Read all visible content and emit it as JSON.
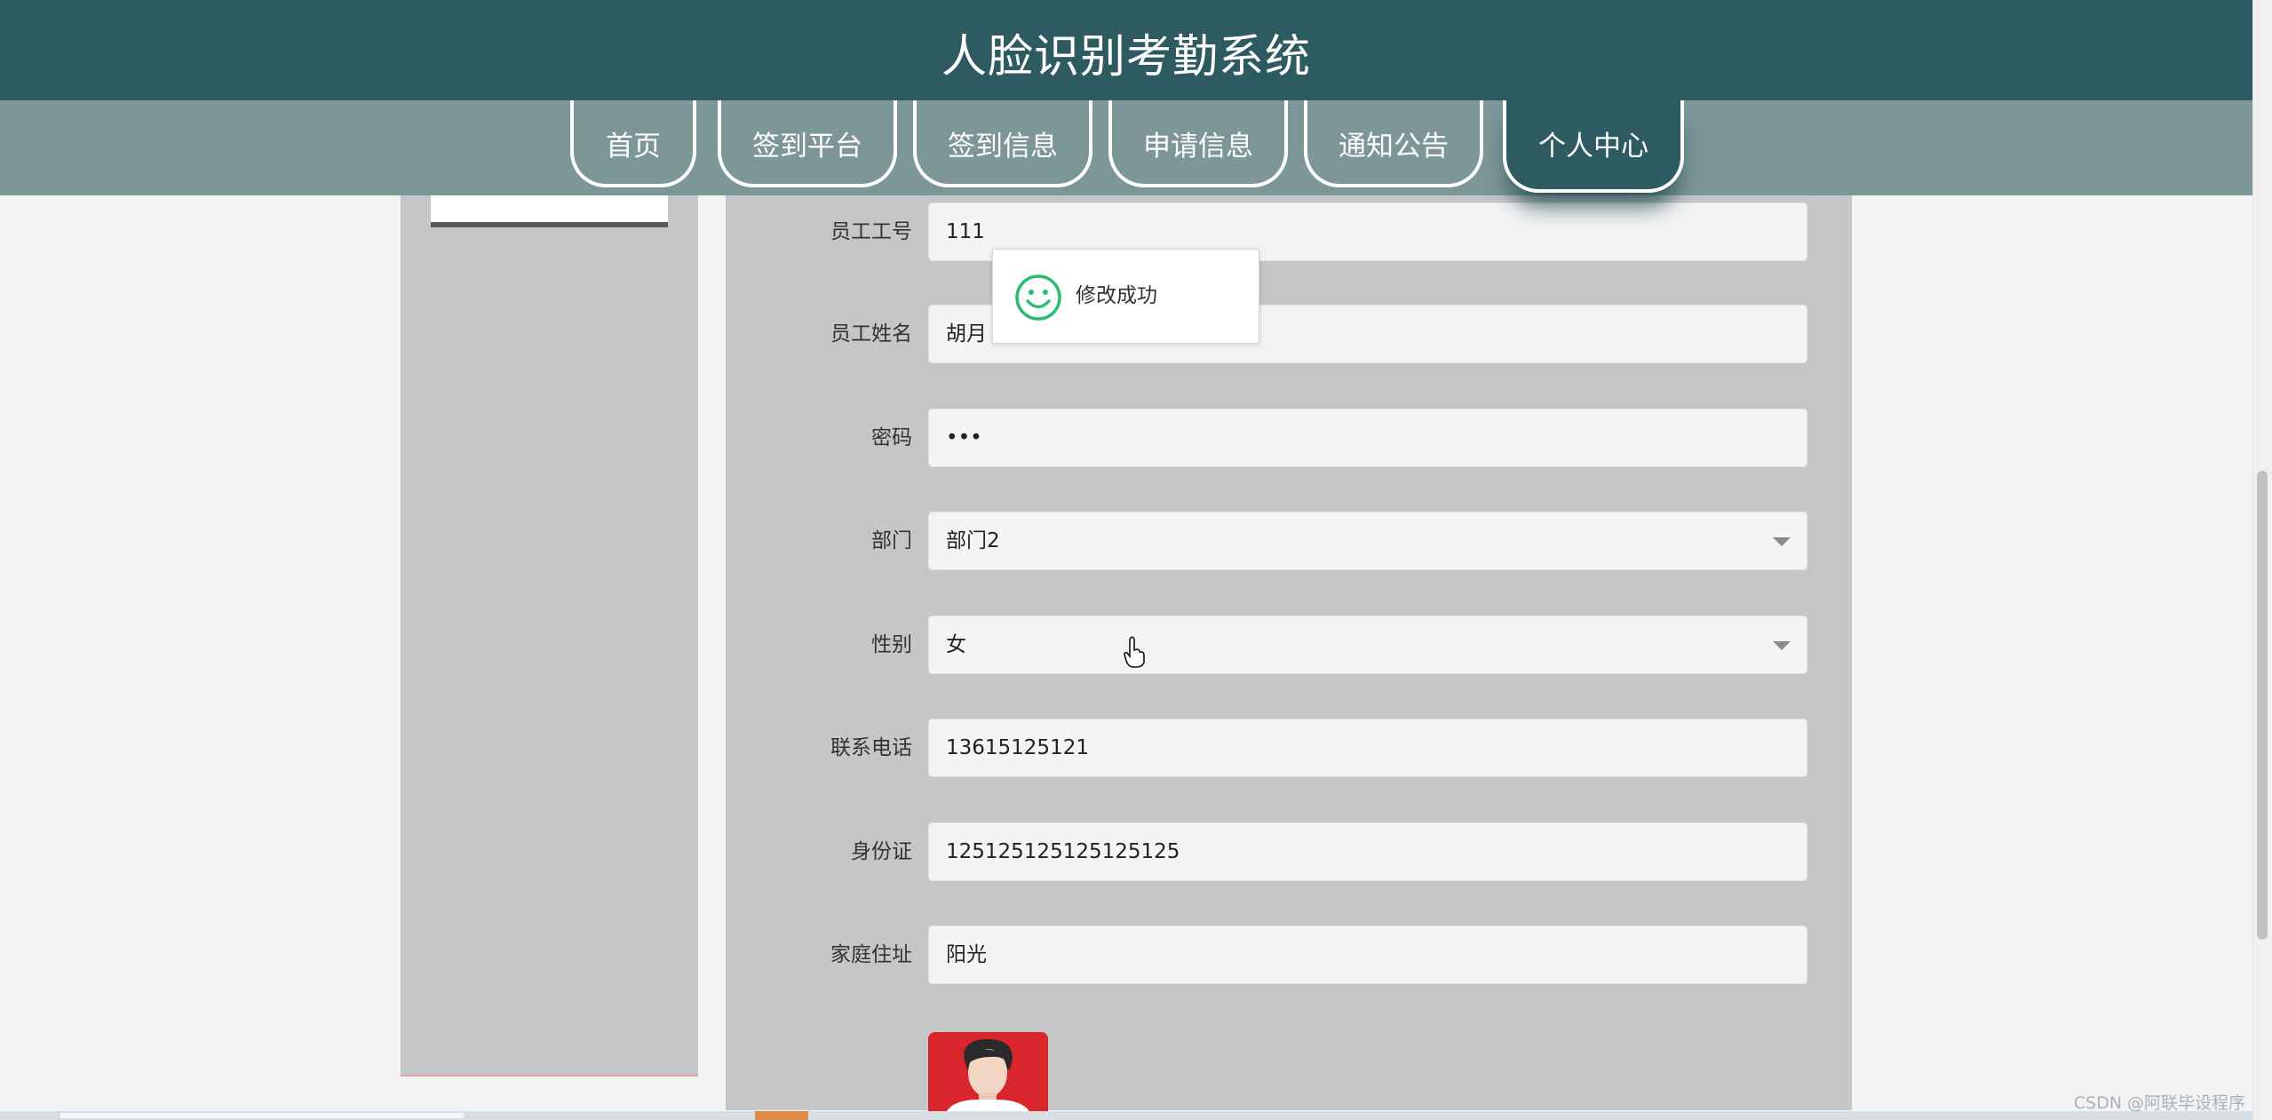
{
  "header": {
    "title": "人脸识别考勤系统"
  },
  "nav": {
    "tabs": [
      {
        "label": "首页"
      },
      {
        "label": "签到平台"
      },
      {
        "label": "签到信息"
      },
      {
        "label": "申请信息"
      },
      {
        "label": "通知公告"
      },
      {
        "label": "个人中心"
      }
    ],
    "active": "个人中心"
  },
  "form": {
    "employee_id": {
      "label": "员工工号",
      "value": "111"
    },
    "employee_name": {
      "label": "员工姓名",
      "value": "胡月"
    },
    "password": {
      "label": "密码",
      "value": "•••"
    },
    "department": {
      "label": "部门",
      "value": "部门2"
    },
    "gender": {
      "label": "性别",
      "value": "女"
    },
    "phone": {
      "label": "联系电话",
      "value": "13615125121"
    },
    "id_card": {
      "label": "身份证",
      "value": "125125125125125125"
    },
    "address": {
      "label": "家庭住址",
      "value": "阳光"
    }
  },
  "toast": {
    "message": "修改成功",
    "icon": "smile-icon"
  },
  "watermark": "CSDN @阿联毕设程序",
  "colors": {
    "header": "#2e5b61",
    "nav": "#7d9698",
    "panel": "#c4c6c7",
    "toast_icon": "#2bbd6e"
  }
}
